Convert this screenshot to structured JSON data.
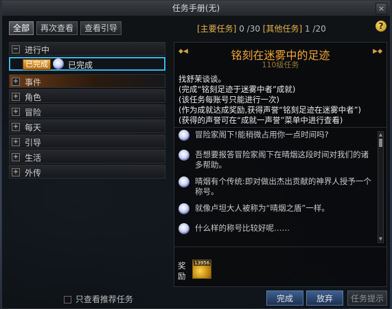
{
  "window": {
    "title": "任务手册(无)"
  },
  "tabs": [
    "全部",
    "再次查看",
    "查看引导"
  ],
  "counters": {
    "main_label": "[主要任务]",
    "main_value": "0 /30",
    "other_label": "[其他任务]",
    "other_value": "1 /20"
  },
  "help_label": "?",
  "close_label": "×",
  "categories": {
    "in_progress": "进行中",
    "quest_badge": "已完成",
    "quest_label": "已完成",
    "event": "事件",
    "character": "角色",
    "adventure": "冒险",
    "daily": "每天",
    "guide": "引导",
    "life": "生活",
    "biography": "外传",
    "expanded_glyph": "−",
    "collapsed_glyph": "+"
  },
  "quest": {
    "title": "铭刻在迷雾中的足迹",
    "level": "110级任务",
    "desc": [
      "找舒茉谈谈。",
      "(完成“铭刻足迹于迷雾中者”成就)",
      "(该任务每账号只能进行一次)",
      "(作为成就达成奖励,获得声誉“铭刻足迹在迷雾中者”)",
      "(获得的声誉可在“成就一声誉”菜单中进行查看)"
    ],
    "dialog": [
      "冒险家阁下!能稍微占用你一点时间吗?",
      "吾想要报答冒险家阁下在晴烟这段时间对我们的诸多帮助。",
      "晴烟有个传统:即对做出杰出贡献的神界人授予一个称号。",
      "就像卢坦大人被称为“晴烟之盾”一样。",
      "什么样的称号比较好呢……"
    ],
    "reward_label": "奖励",
    "reward_qty": "13956"
  },
  "footer": {
    "filter_label": "只查看推荐任务",
    "complete": "完成",
    "abandon": "放弃",
    "hint": "任务提示"
  },
  "icons": {
    "arrow_left": "◆◀",
    "arrow_right": "▶◆",
    "scroll_up": "▲",
    "scroll_down": "▼"
  }
}
